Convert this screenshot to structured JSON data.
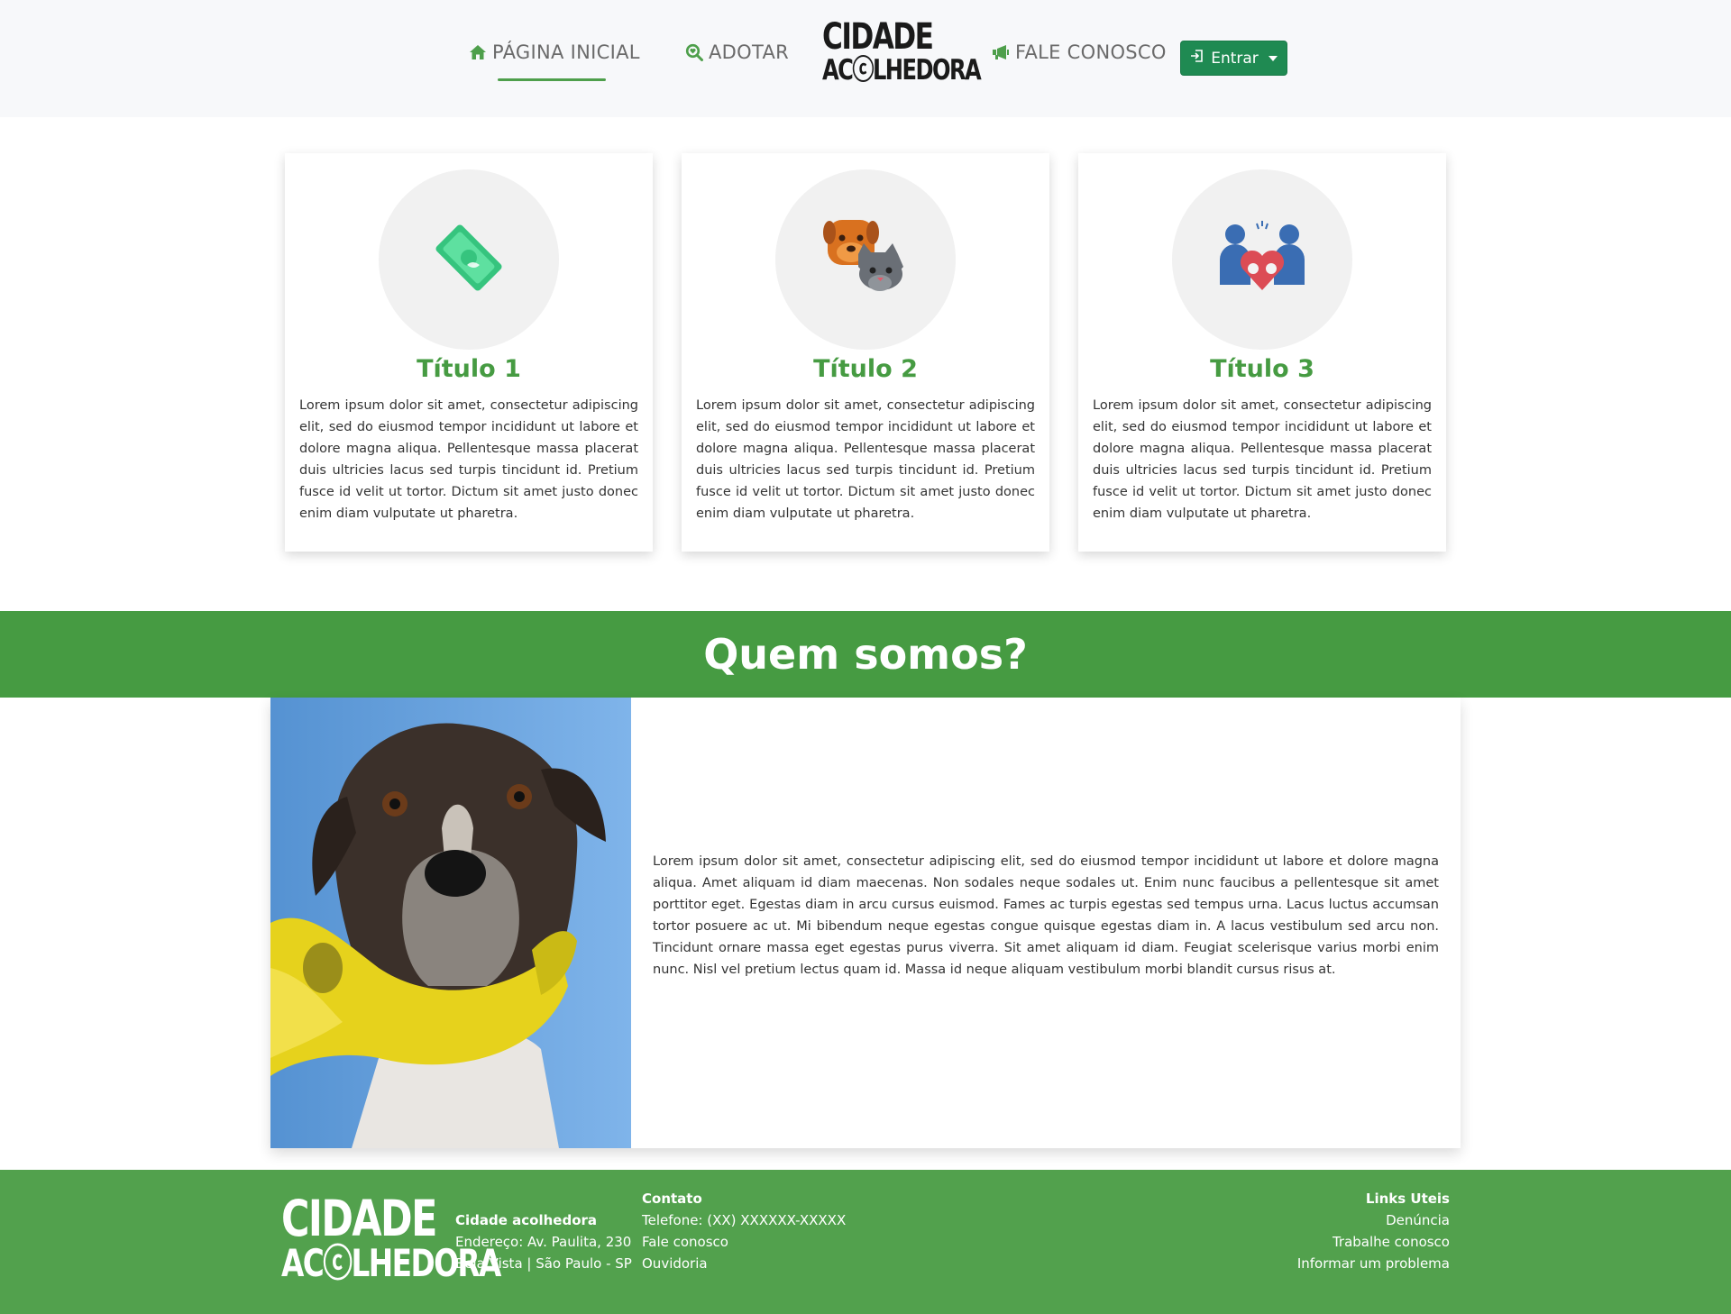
{
  "nav": {
    "home_label": "PÁGINA INICIAL",
    "adopt_label": "ADOTAR",
    "contact_label": "FALE CONOSCO",
    "login_label": "Entrar",
    "logo_line1": "CIDADE",
    "logo_line2": "ACⓒLHEDORA",
    "active_color": "#4e9f4b",
    "login_color": "#1f8a52"
  },
  "cards": [
    {
      "icon": "money-icon",
      "title": "Título 1",
      "text": "Lorem ipsum dolor sit amet, consectetur adipiscing elit, sed do eiusmod tempor incididunt ut labore et dolore magna aliqua. Pellentesque massa placerat duis ultricies lacus sed turpis tincidunt id. Pretium fusce id velit ut tortor. Dictum sit amet justo donec enim diam vulputate ut pharetra."
    },
    {
      "icon": "dog-cat-icon",
      "title": "Título 2",
      "text": "Lorem ipsum dolor sit amet, consectetur adipiscing elit, sed do eiusmod tempor incididunt ut labore et dolore magna aliqua. Pellentesque massa placerat duis ultricies lacus sed turpis tincidunt id. Pretium fusce id velit ut tortor. Dictum sit amet justo donec enim diam vulputate ut pharetra."
    },
    {
      "icon": "family-pets-heart-icon",
      "title": "Título 3",
      "text": "Lorem ipsum dolor sit amet, consectetur adipiscing elit, sed do eiusmod tempor incididunt ut labore et dolore magna aliqua. Pellentesque massa placerat duis ultricies lacus sed turpis tincidunt id. Pretium fusce id velit ut tortor. Dictum sit amet justo donec enim diam vulputate ut pharetra."
    }
  ],
  "about": {
    "title": "Quem somos?",
    "text": "Lorem ipsum dolor sit amet, consectetur adipiscing elit, sed do eiusmod tempor incididunt ut labore et dolore magna aliqua. Amet aliquam id diam maecenas. Non sodales neque sodales ut. Enim nunc faucibus a pellentesque sit amet porttitor eget. Egestas diam in arcu cursus euismod. Fames ac turpis egestas sed tempus urna. Lacus luctus accumsan tortor posuere ac ut. Mi bibendum neque egestas congue quisque egestas diam in. A lacus vestibulum sed arcu non. Tincidunt ornare massa eget egestas purus viverra. Sit amet aliquam id diam. Feugiat scelerisque varius morbi enim nunc. Nisl vel pretium lectus quam id. Massa id neque aliquam vestibulum morbi blandit cursus risus at.",
    "band_color": "#469b42",
    "photo": "dog-with-yellow-bandana-photo"
  },
  "footer": {
    "logo_line1": "CIDADE",
    "logo_line2": "ACⓒLHEDORA",
    "org_name": "Cidade acolhedora",
    "address": "Endereço: Av. Paulita, 230",
    "district": "Bela Vista | São Paulo - SP",
    "contact_title": "Contato",
    "phone": "Telefone: (XX) XXXXXX-XXXXX",
    "contact_link": "Fale conosco",
    "ombudsman_link": "Ouvidoria",
    "links_title": "Links Uteis",
    "link_report": "Denúncia",
    "link_work": "Trabalhe conosco",
    "link_problem": "Informar um problema",
    "bg_color": "#52a14d"
  }
}
